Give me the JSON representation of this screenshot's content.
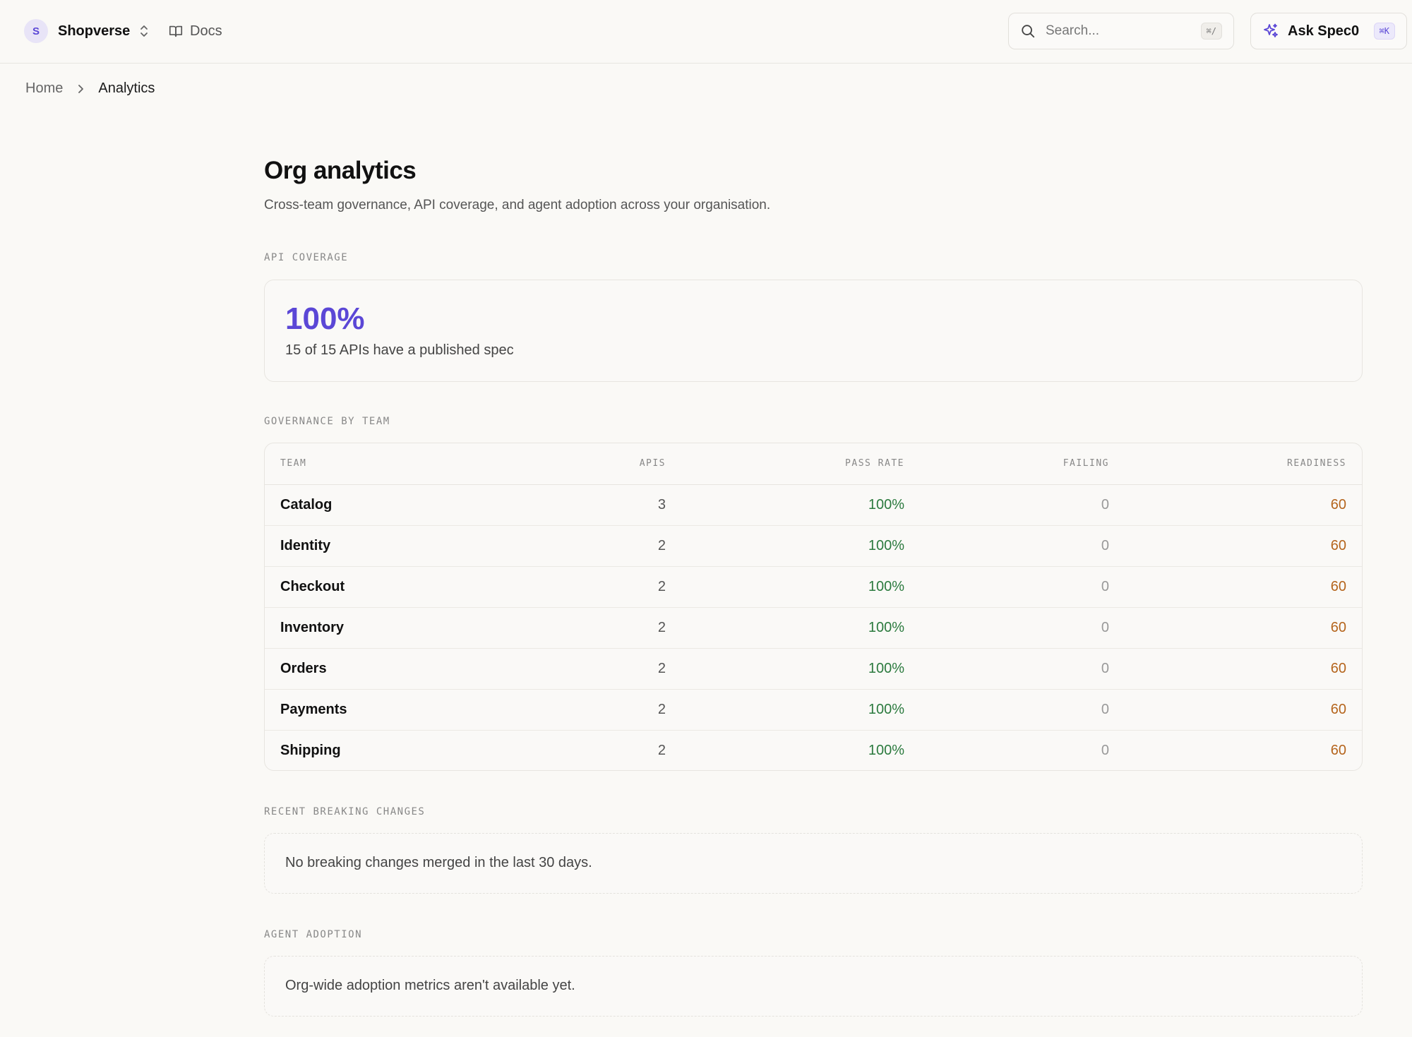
{
  "topbar": {
    "org": {
      "avatar_initial": "S",
      "name": "Shopverse"
    },
    "docs_label": "Docs",
    "search": {
      "placeholder": "Search...",
      "shortcut": "⌘/"
    },
    "ask": {
      "label": "Ask Spec0",
      "shortcut": "⌘K"
    }
  },
  "breadcrumb": {
    "home": "Home",
    "current": "Analytics"
  },
  "page": {
    "title": "Org analytics",
    "subtitle": "Cross-team governance, API coverage, and agent adoption across your organisation."
  },
  "coverage": {
    "section_label": "API COVERAGE",
    "value": "100%",
    "description": "15 of 15 APIs have a published spec"
  },
  "governance": {
    "section_label": "GOVERNANCE BY TEAM",
    "columns": {
      "team": "TEAM",
      "apis": "APIS",
      "pass_rate": "PASS RATE",
      "failing": "FAILING",
      "readiness": "READINESS"
    },
    "rows": [
      {
        "team": "Catalog",
        "apis": "3",
        "pass_rate": "100%",
        "failing": "0",
        "readiness": "60"
      },
      {
        "team": "Identity",
        "apis": "2",
        "pass_rate": "100%",
        "failing": "0",
        "readiness": "60"
      },
      {
        "team": "Checkout",
        "apis": "2",
        "pass_rate": "100%",
        "failing": "0",
        "readiness": "60"
      },
      {
        "team": "Inventory",
        "apis": "2",
        "pass_rate": "100%",
        "failing": "0",
        "readiness": "60"
      },
      {
        "team": "Orders",
        "apis": "2",
        "pass_rate": "100%",
        "failing": "0",
        "readiness": "60"
      },
      {
        "team": "Payments",
        "apis": "2",
        "pass_rate": "100%",
        "failing": "0",
        "readiness": "60"
      },
      {
        "team": "Shipping",
        "apis": "2",
        "pass_rate": "100%",
        "failing": "0",
        "readiness": "60"
      }
    ]
  },
  "breaking_changes": {
    "section_label": "RECENT BREAKING CHANGES",
    "empty_text": "No breaking changes merged in the last 30 days."
  },
  "agent_adoption": {
    "section_label": "AGENT ADOPTION",
    "empty_text": "Org-wide adoption metrics aren't available yet."
  },
  "colors": {
    "accent": "#5b47d6",
    "pass": "#2b7a3e",
    "readiness": "#b5651d",
    "background": "#faf9f6"
  },
  "icons": {
    "org_chevron": "chevron-up-down-icon",
    "docs": "book-open-icon",
    "search": "search-icon",
    "ask": "sparkle-icon",
    "breadcrumb_separator": "chevron-right-icon"
  }
}
